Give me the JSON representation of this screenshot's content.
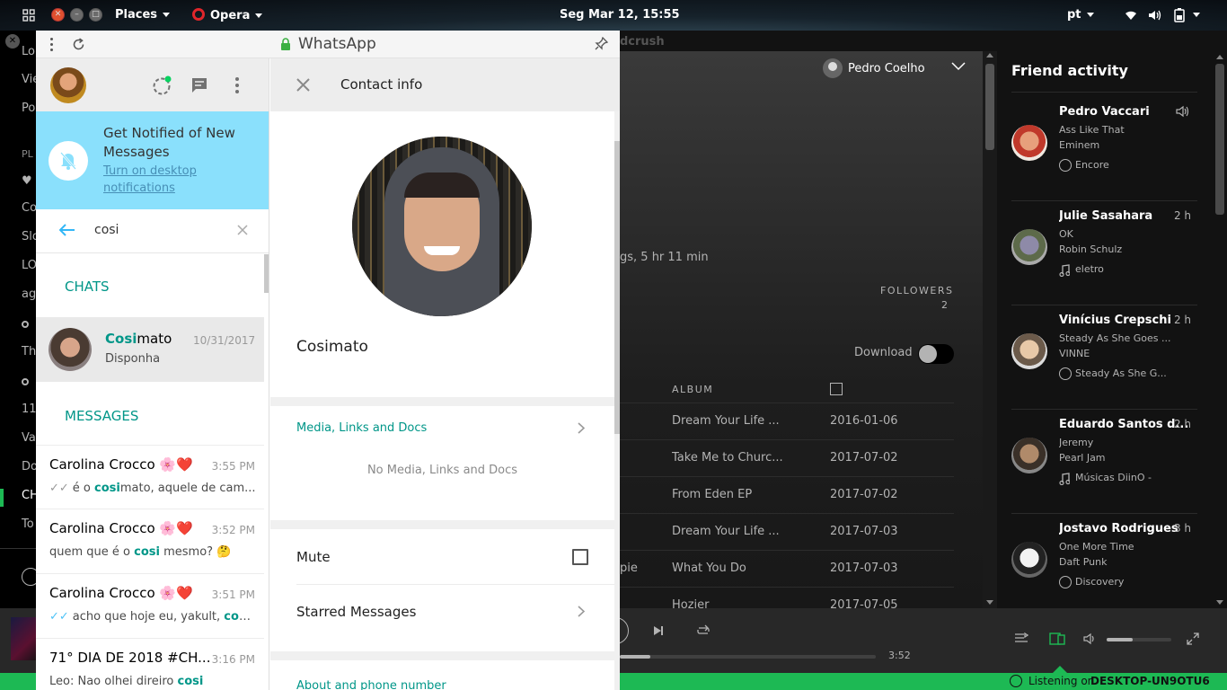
{
  "topbar": {
    "places": "Places",
    "opera": "Opera",
    "clock": "Seg Mar 12, 15:55",
    "lang": "pt",
    "opera_color": "#e0262b"
  },
  "spotify": {
    "title_partial": "dcrush",
    "user": "Pedro Coelho",
    "songs_info": "gs, 5 hr 11 min",
    "followers_label": "FOLLOWERS",
    "followers_count": "2",
    "download_label": "Download",
    "album_header": "ALBUM",
    "rows": [
      {
        "album": "Dream Your Life ...",
        "date": "2016-01-06",
        "extra": ""
      },
      {
        "album": "Take Me to Churc...",
        "date": "2017-07-02",
        "extra": ""
      },
      {
        "album": "From Eden EP",
        "date": "2017-07-02",
        "extra": ""
      },
      {
        "album": "Dream Your Life ...",
        "date": "2017-07-03",
        "extra": ""
      },
      {
        "album": "What You Do",
        "date": "2017-07-03",
        "extra": "pie"
      },
      {
        "album": "Hozier",
        "date": "2017-07-05",
        "extra": ""
      }
    ],
    "left_fragments": [
      "Lo",
      "Vie",
      "Po",
      "PL",
      "♥",
      "Co",
      "Slo",
      "LO",
      "ag",
      "Th",
      "11",
      "Va",
      "Do",
      "CH",
      "To"
    ],
    "elapsed_time": "3:52",
    "progress_fraction": 0.12,
    "volume_fraction": 0.4,
    "listening_label": "Listening on",
    "listening_device": "DESKTOP-UN9OTU6",
    "accent": "#1db954",
    "friend_activity": {
      "title": "Friend activity",
      "items": [
        {
          "name": "Pedro Vaccari",
          "time": "",
          "track": "Ass Like That",
          "artist": "Eminem",
          "context": "Encore",
          "ctx_icon": "album-icon"
        },
        {
          "name": "Julie Sasahara",
          "time": "2 h",
          "track": "OK",
          "artist": "Robin Schulz",
          "context": "eletro",
          "ctx_icon": "music-note-icon"
        },
        {
          "name": "Vinícius Crepschi",
          "time": "2 h",
          "track": "Steady As She Goes ...",
          "artist": "VINNE",
          "context": "Steady As She G...",
          "ctx_icon": "album-icon"
        },
        {
          "name": "Eduardo Santos d...",
          "time": "2 h",
          "track": "Jeremy",
          "artist": "Pearl Jam",
          "context": "Músicas DiinO -",
          "ctx_icon": "music-note-icon"
        },
        {
          "name": "Jostavo Rodrigues",
          "time": "3 h",
          "track": "One More Time",
          "artist": "Daft Punk",
          "context": "Discovery",
          "ctx_icon": "album-icon"
        }
      ]
    }
  },
  "whatsapp": {
    "window_title": "WhatsApp",
    "notification": {
      "title": "Get Notified of New Messages",
      "link": "Turn on desktop notifications"
    },
    "search": {
      "value": "cosi"
    },
    "chats_label": "CHATS",
    "messages_label": "MESSAGES",
    "chat_result": {
      "name_highlight": "Cosi",
      "name_rest": "mato",
      "date": "10/31/2017",
      "message": "Disponha"
    },
    "messages": [
      {
        "sender": "Carolina Crocco 🌸❤️",
        "time": "3:55 PM",
        "ticks": "✓✓",
        "ticks_color": "#999999",
        "pre": "é o ",
        "hl": "cosi",
        "post": "mato, aquele de cam..."
      },
      {
        "sender": "Carolina Crocco 🌸❤️",
        "time": "3:52 PM",
        "ticks": "",
        "ticks_color": "",
        "pre": "quem que é o ",
        "hl": "cosi",
        "post": " mesmo? 🤔"
      },
      {
        "sender": "Carolina Crocco 🌸❤️",
        "time": "3:51 PM",
        "ticks": "✓✓",
        "ticks_color": "#4fc3f7",
        "pre": "acho que hoje eu, yakult, ",
        "hl": "cosi",
        "post": " ..."
      },
      {
        "sender": "71° DIA DE 2018 #CH...",
        "time": "3:16 PM",
        "ticks": "",
        "ticks_color": "",
        "pre": "Leo: Nao olhei direiro ",
        "hl": "cosi",
        "post": ""
      }
    ],
    "contact": {
      "header": "Contact info",
      "name": "Cosimato",
      "media_label": "Media, Links and Docs",
      "no_media": "No Media, Links and Docs",
      "mute_label": "Mute",
      "starred_label": "Starred Messages",
      "about_label": "About and phone number"
    },
    "teal": "#009688",
    "notif_bg": "#8ae0fc"
  }
}
